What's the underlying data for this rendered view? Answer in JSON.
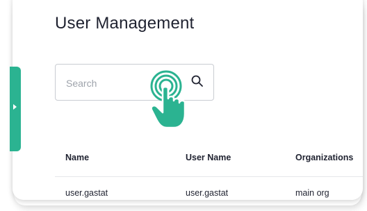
{
  "page": {
    "title": "User Management"
  },
  "search": {
    "placeholder": "Search",
    "value": ""
  },
  "icons": {
    "search": "search-icon",
    "hand": "pointing-hand-icon",
    "sidebar_toggle": "chevron-right-icon"
  },
  "colors": {
    "accent": "#2bb391",
    "text": "#1f2230",
    "border": "#c9ccd2",
    "placeholder": "#9ea3ab"
  },
  "table": {
    "columns": [
      "Name",
      "User Name",
      "Organizations"
    ],
    "rows": [
      [
        "user.gastat",
        "user.gastat",
        "main org"
      ]
    ]
  }
}
